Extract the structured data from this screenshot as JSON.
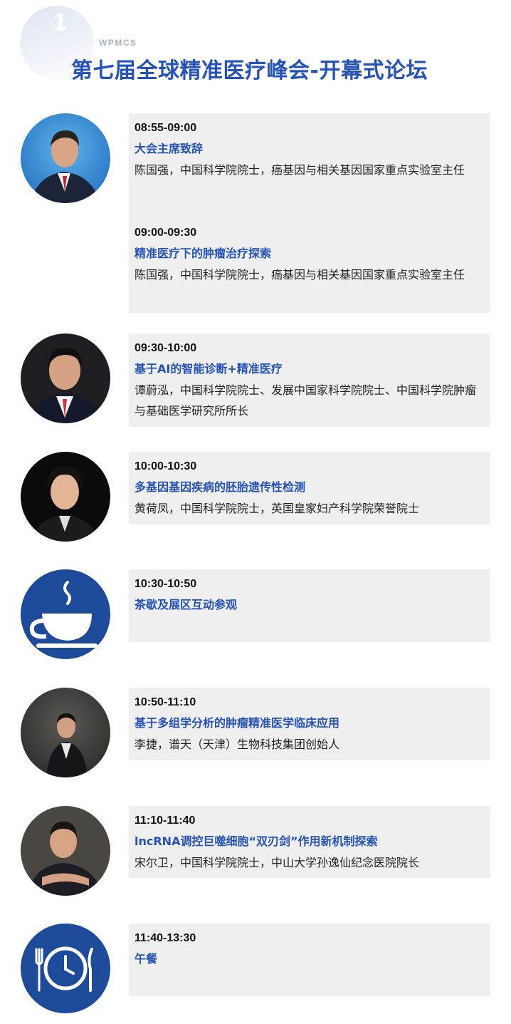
{
  "header": {
    "number": "1",
    "tag": "WPMCS",
    "title": "第七届全球精准医疗峰会-开幕式论坛"
  },
  "colors": {
    "accent": "#2452b8",
    "icon_bg": "#1e4a9a",
    "card_bg": "#efefef"
  },
  "sessions": [
    {
      "icon": "portrait-man-blue-background",
      "slots": [
        {
          "time": "08:55-09:00",
          "topic": "大会主席致辞",
          "speaker": "陈国强，中国科学院院士，癌基因与相关基因国家重点实验室主任"
        },
        {
          "time": "09:00-09:30",
          "topic": "精准医疗下的肿瘤治疗探索",
          "speaker": "陈国强，中国科学院院士，癌基因与相关基因国家重点实验室主任"
        }
      ]
    },
    {
      "icon": "portrait-man-dark-background",
      "slots": [
        {
          "time": "09:30-10:00",
          "topic": "基于AI的智能诊断+精准医疗",
          "speaker": "谭蔚泓，中国科学院院士、发展中国家科学院院士、中国科学院肿瘤与基础医学研究所所长"
        }
      ]
    },
    {
      "icon": "portrait-man-black-background",
      "slots": [
        {
          "time": "10:00-10:30",
          "topic": "多基因基因疾病的胚胎遗传性检测",
          "speaker": "黄荷凤，中国科学院院士，英国皇家妇产科学院荣誉院士"
        }
      ]
    },
    {
      "icon": "coffee-cup-icon",
      "slots": [
        {
          "time": "10:30-10:50",
          "topic": "茶歇及展区互动参观",
          "speaker": ""
        }
      ]
    },
    {
      "icon": "portrait-man-gray-background",
      "slots": [
        {
          "time": "10:50-11:10",
          "topic": "基于多组学分析的肿瘤精准医学临床应用",
          "speaker": "李捷，谱天（天津）生物科技集团创始人"
        }
      ]
    },
    {
      "icon": "portrait-man-arms-folded",
      "slots": [
        {
          "time": "11:10-11:40",
          "topic": "lncRNA调控巨噬细胞“双刃剑”作用新机制探索",
          "speaker": "宋尔卫，中国科学院院士，中山大学孙逸仙纪念医院院长"
        }
      ]
    },
    {
      "icon": "lunch-clock-cutlery-icon",
      "slots": [
        {
          "time": "11:40-13:30",
          "topic": "午餐",
          "speaker": ""
        }
      ]
    }
  ]
}
